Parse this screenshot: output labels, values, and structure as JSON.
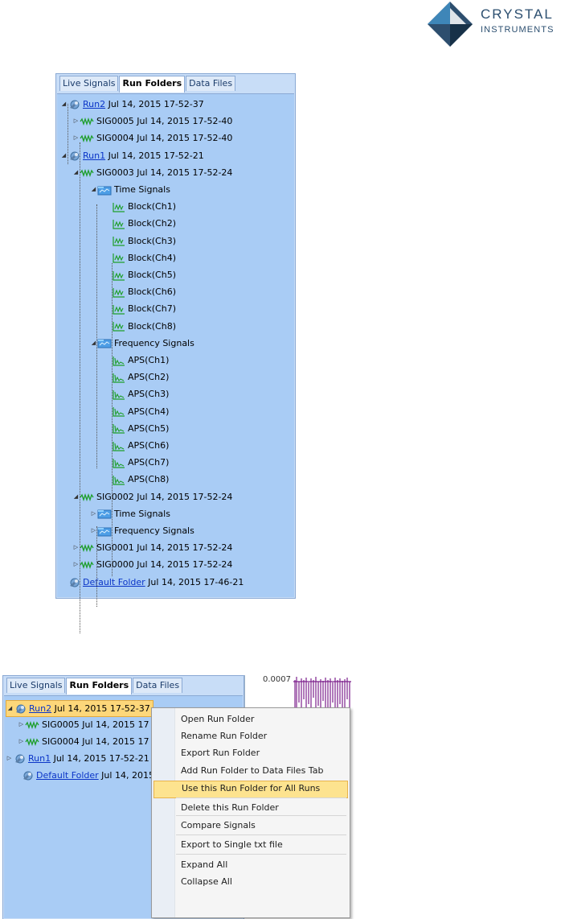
{
  "logo": {
    "line1": "CRYSTAL",
    "line2": "INSTRUMENTS"
  },
  "top_panel": {
    "tabs": [
      "Live Signals",
      "Run Folders",
      "Data Files"
    ],
    "tree": [
      {
        "kind": "run",
        "name": "Run2",
        "date": "Jul 14, 2015 17-52-37"
      },
      {
        "kind": "sig",
        "name": "SIG0005",
        "date": "Jul 14, 2015 17-52-40"
      },
      {
        "kind": "sig",
        "name": "SIG0004",
        "date": "Jul 14, 2015 17-52-40"
      },
      {
        "kind": "run",
        "name": "Run1",
        "date": "Jul 14, 2015 17-52-21"
      },
      {
        "kind": "sig",
        "name": "SIG0003",
        "date": "Jul 14, 2015 17-52-24"
      },
      {
        "kind": "group",
        "name": "Time Signals"
      },
      {
        "kind": "time",
        "name": "Block(Ch1)"
      },
      {
        "kind": "time",
        "name": "Block(Ch2)"
      },
      {
        "kind": "time",
        "name": "Block(Ch3)"
      },
      {
        "kind": "time",
        "name": "Block(Ch4)"
      },
      {
        "kind": "time",
        "name": "Block(Ch5)"
      },
      {
        "kind": "time",
        "name": "Block(Ch6)"
      },
      {
        "kind": "time",
        "name": "Block(Ch7)"
      },
      {
        "kind": "time",
        "name": "Block(Ch8)"
      },
      {
        "kind": "group",
        "name": "Frequency Signals"
      },
      {
        "kind": "freq",
        "name": "APS(Ch1)"
      },
      {
        "kind": "freq",
        "name": "APS(Ch2)"
      },
      {
        "kind": "freq",
        "name": "APS(Ch3)"
      },
      {
        "kind": "freq",
        "name": "APS(Ch4)"
      },
      {
        "kind": "freq",
        "name": "APS(Ch5)"
      },
      {
        "kind": "freq",
        "name": "APS(Ch6)"
      },
      {
        "kind": "freq",
        "name": "APS(Ch7)"
      },
      {
        "kind": "freq",
        "name": "APS(Ch8)"
      },
      {
        "kind": "sig",
        "name": "SIG0002",
        "date": "Jul 14, 2015 17-52-24"
      },
      {
        "kind": "group",
        "name": "Time Signals"
      },
      {
        "kind": "group",
        "name": "Frequency Signals"
      },
      {
        "kind": "sig",
        "name": "SIG0001",
        "date": "Jul 14, 2015 17-52-24"
      },
      {
        "kind": "sig",
        "name": "SIG0000",
        "date": "Jul 14, 2015 17-52-24"
      },
      {
        "kind": "run",
        "name": "Default Folder",
        "date": "Jul 14, 2015 17-46-21"
      }
    ]
  },
  "bottom_panel": {
    "tabs": [
      "Live Signals",
      "Run Folders",
      "Data Files"
    ],
    "plot_value": "0.0007",
    "tree": [
      {
        "kind": "run",
        "name": "Run2",
        "date": "Jul 14, 2015 17-52-37",
        "selected": true
      },
      {
        "kind": "sig",
        "name": "SIG0005",
        "date": "Jul 14, 2015 17"
      },
      {
        "kind": "sig",
        "name": "SIG0004",
        "date": "Jul 14, 2015 17"
      },
      {
        "kind": "run",
        "name": "Run1",
        "date": "Jul 14, 2015 17-52-21"
      },
      {
        "kind": "run",
        "name": "Default Folder",
        "date": "Jul 14, 2015"
      }
    ]
  },
  "context_menu": {
    "items": [
      "Open Run Folder",
      "Rename Run Folder",
      "Export Run Folder",
      "Add Run Folder to Data Files Tab",
      "Use this Run Folder for All Runs",
      "Delete this Run Folder",
      "Compare Signals",
      "Export to Single txt file",
      "Expand All",
      "Collapse All"
    ],
    "highlighted_index": 4
  },
  "colors": {
    "panel_bg": "#a9ccf5",
    "link": "#0b35c7",
    "highlight": "#fde38f",
    "signal_green": "#1e9e2a"
  }
}
